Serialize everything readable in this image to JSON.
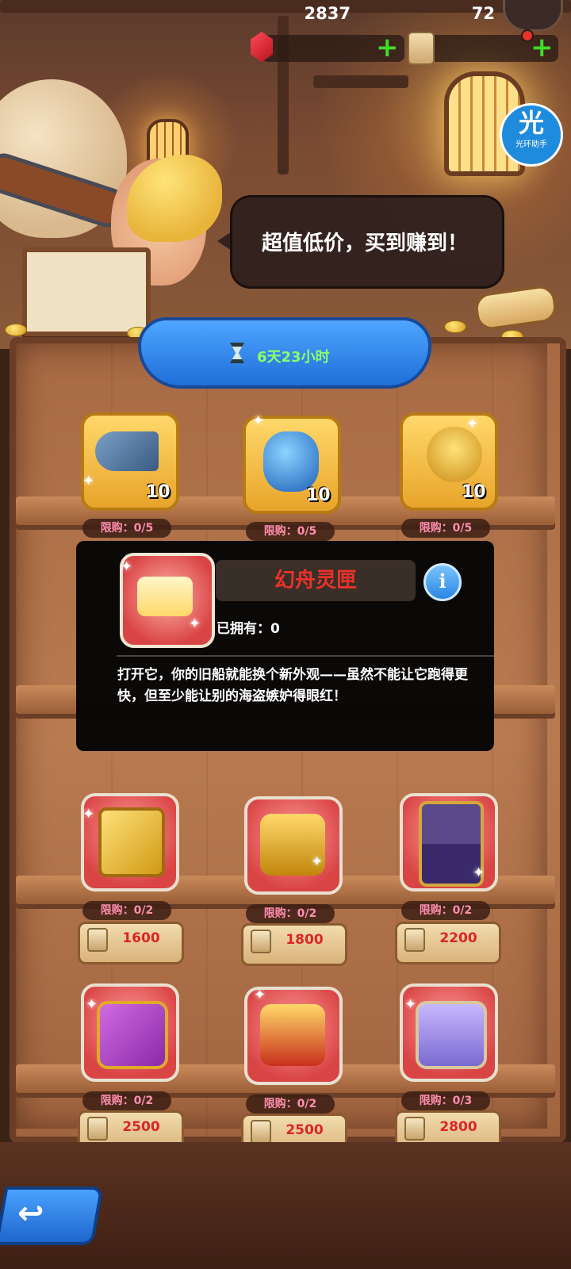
{
  "header": {
    "gems": "2837",
    "scrolls": "72",
    "gem_icon": "ruby-gem-icon",
    "scroll_icon": "scroll-icon",
    "plus_symbol": "+",
    "assistant_char": "光",
    "assistant_label": "光环助手"
  },
  "speech": {
    "text": "超值低价，买到赚到！"
  },
  "timer": {
    "label": "6天23小时"
  },
  "items_row1": [
    {
      "name": "horn",
      "qty": "10",
      "limit": "限购：0/5"
    },
    {
      "name": "crystal",
      "qty": "10",
      "limit": "限购：0/5"
    },
    {
      "name": "cannon",
      "qty": "10",
      "limit": "限购：0/5"
    }
  ],
  "items_row3": [
    {
      "name": "banner",
      "limit": "限购：0/2",
      "price": "1600"
    },
    {
      "name": "shield-chest",
      "limit": "限购：0/2",
      "price": "1800"
    },
    {
      "name": "card",
      "limit": "限购：0/2",
      "price": "2200"
    }
  ],
  "items_row4": [
    {
      "name": "purple-chest",
      "limit": "限购：0/2",
      "price": "2500"
    },
    {
      "name": "red-gold-chest",
      "limit": "限购：0/2",
      "price": "2500"
    },
    {
      "name": "lavender-chest",
      "limit": "限购：0/3",
      "price": "2800"
    }
  ],
  "popup": {
    "title": "幻舟灵匣",
    "owned": "已拥有：0",
    "description": "打开它，你的旧船就能换个新外观——虽然不能让它跑得更快，但至少能让别的海盗嫉妒得眼红！",
    "info_symbol": "i"
  },
  "back": {
    "symbol": "↩"
  },
  "colors": {
    "accent_blue": "#1f6fd8",
    "plus_green": "#3fdc2a",
    "price_red": "#d9262a",
    "limit_pink": "#ff8fb0",
    "timer_green": "#8dff6a",
    "title_red": "#e8322a"
  }
}
